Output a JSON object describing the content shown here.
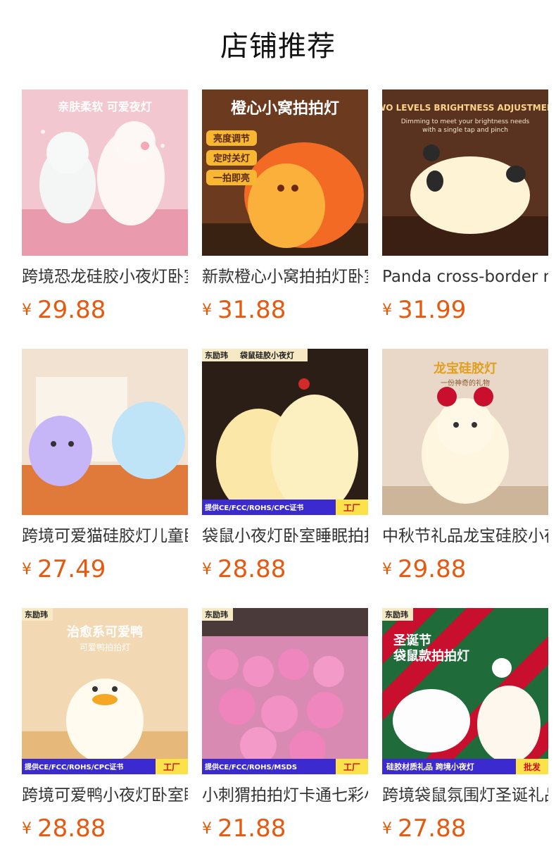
{
  "header": {
    "title": "店铺推荐"
  },
  "products": [
    {
      "title": "跨境恐龙硅胶小夜灯卧室睡眠",
      "currency": "¥",
      "price": "29.88",
      "image_text": [
        "亲肤柔软 可爱夜灯"
      ]
    },
    {
      "title": "新款橙心小窝拍拍灯卧室睡眠",
      "currency": "¥",
      "price": "31.88",
      "image_text": [
        "橙心小窝拍拍灯",
        "亮度调节",
        "定时关灯",
        "一拍即亮"
      ]
    },
    {
      "title": "Panda cross-border night light",
      "currency": "¥",
      "price": "31.99",
      "image_text": [
        "TWO LEVELS BRIGHTNESS ADJUSTMENT",
        "Dimming to meet your brightness needs",
        "with a single tap and pinch"
      ]
    },
    {
      "title": "跨境可爱猫硅胶灯儿童卧室",
      "currency": "¥",
      "price": "27.49",
      "image_text": []
    },
    {
      "title": "袋鼠小夜灯卧室睡眠拍拍灯",
      "currency": "¥",
      "price": "28.88",
      "image_text": [
        "东励玮",
        "袋鼠硅胶小夜灯",
        "提供CE/FCC/ROHS/CPC证书",
        "工厂"
      ]
    },
    {
      "title": "中秋节礼品龙宝硅胶小夜灯",
      "currency": "¥",
      "price": "29.88",
      "image_text": [
        "龙宝硅胶灯",
        "一份神奇的礼物"
      ]
    },
    {
      "title": "跨境可爱鸭小夜灯卧室睡眠",
      "currency": "¥",
      "price": "28.88",
      "image_text": [
        "东励玮",
        "治愈系可爱鸭",
        "可爱鸭拍拍灯",
        "提供CE/FCC/ROHS/CPC证书",
        "工厂"
      ]
    },
    {
      "title": "小刺猬拍拍灯卡通七彩小夜灯",
      "currency": "¥",
      "price": "21.88",
      "image_text": [
        "东励玮",
        "提供CE/FCC/ROHS/MSDS",
        "工厂"
      ]
    },
    {
      "title": "跨境袋鼠氛围灯圣诞礼品",
      "currency": "¥",
      "price": "27.88",
      "image_text": [
        "东励玮",
        "圣诞节",
        "袋鼠款拍拍灯",
        "硅胶材质礼品 跨境小夜灯",
        "批发"
      ]
    }
  ]
}
